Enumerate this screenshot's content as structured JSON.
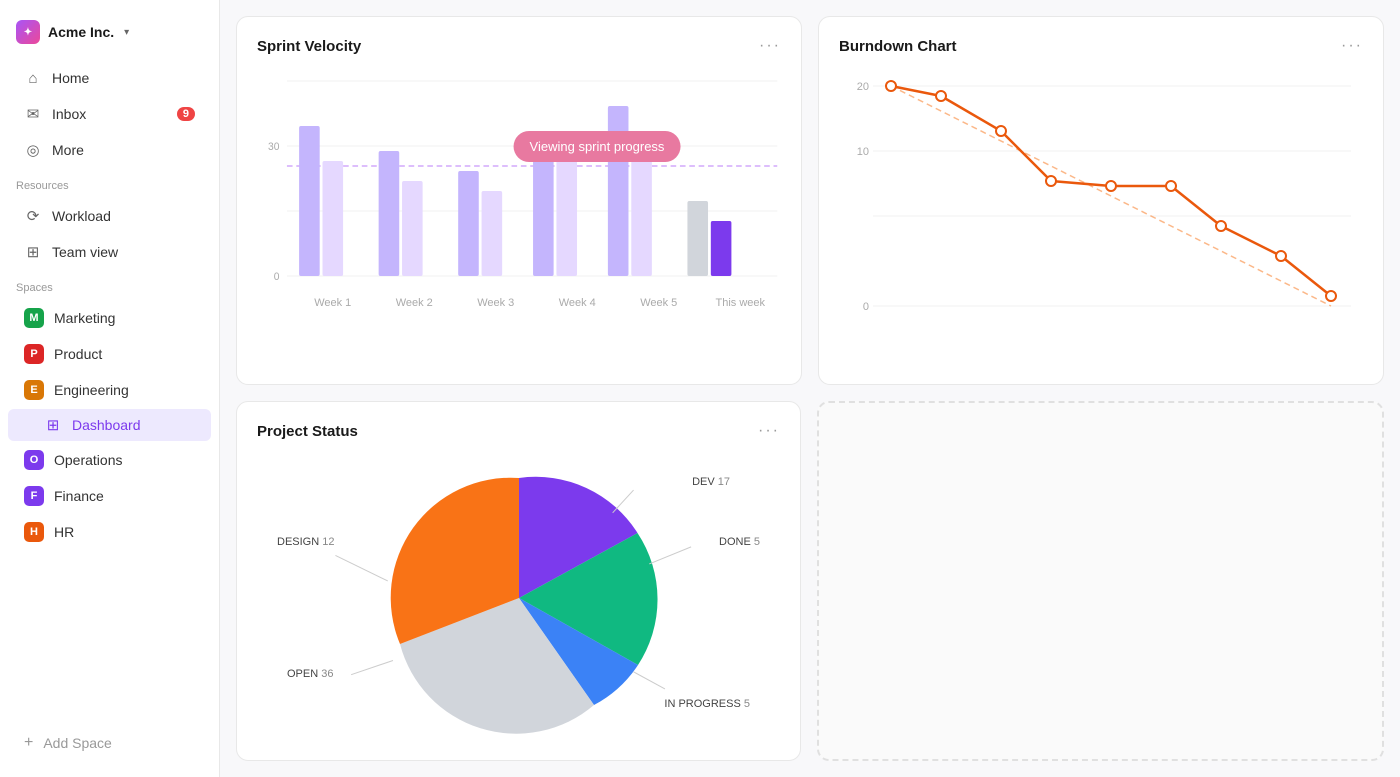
{
  "app": {
    "name": "Acme Inc.",
    "chevron": "▾"
  },
  "nav": {
    "home": "Home",
    "inbox": "Inbox",
    "inbox_count": "9",
    "more": "More"
  },
  "resources": {
    "label": "Resources",
    "workload": "Workload",
    "team_view": "Team view"
  },
  "spaces": {
    "label": "Spaces",
    "items": [
      {
        "id": "marketing",
        "letter": "M",
        "name": "Marketing",
        "color": "#16a34a"
      },
      {
        "id": "product",
        "letter": "P",
        "name": "Product",
        "color": "#dc2626"
      },
      {
        "id": "engineering",
        "letter": "E",
        "name": "Engineering",
        "color": "#d97706"
      },
      {
        "id": "operations",
        "letter": "O",
        "name": "Operations",
        "color": "#7c3aed"
      },
      {
        "id": "finance",
        "letter": "F",
        "name": "Finance",
        "color": "#7c3aed"
      },
      {
        "id": "hr",
        "letter": "H",
        "name": "HR",
        "color": "#ea580c"
      }
    ],
    "active_space": "engineering",
    "dashboard_label": "Dashboard",
    "add_space": "Add Space"
  },
  "sprint_velocity": {
    "title": "Sprint Velocity",
    "y_labels": [
      "",
      "30",
      "",
      "0"
    ],
    "weeks": [
      "Week 1",
      "Week 2",
      "Week 3",
      "Week 4",
      "Week 5",
      "This week"
    ],
    "tooltip": "Viewing sprint progress",
    "more_dots": "···"
  },
  "burndown": {
    "title": "Burndown Chart",
    "more_dots": "···",
    "y_top": "20",
    "y_mid": "10",
    "y_bot": "0"
  },
  "project_status": {
    "title": "Project Status",
    "more_dots": "···",
    "segments": [
      {
        "id": "dev",
        "label": "DEV",
        "count": "17",
        "color": "#7c3aed"
      },
      {
        "id": "done",
        "label": "DONE",
        "count": "5",
        "color": "#10b981"
      },
      {
        "id": "in_progress",
        "label": "IN PROGRESS",
        "count": "5",
        "color": "#3b82f6"
      },
      {
        "id": "open",
        "label": "OPEN",
        "count": "36",
        "color": "#d1d5db"
      },
      {
        "id": "design",
        "label": "DESIGN",
        "count": "12",
        "color": "#f97316"
      }
    ]
  }
}
